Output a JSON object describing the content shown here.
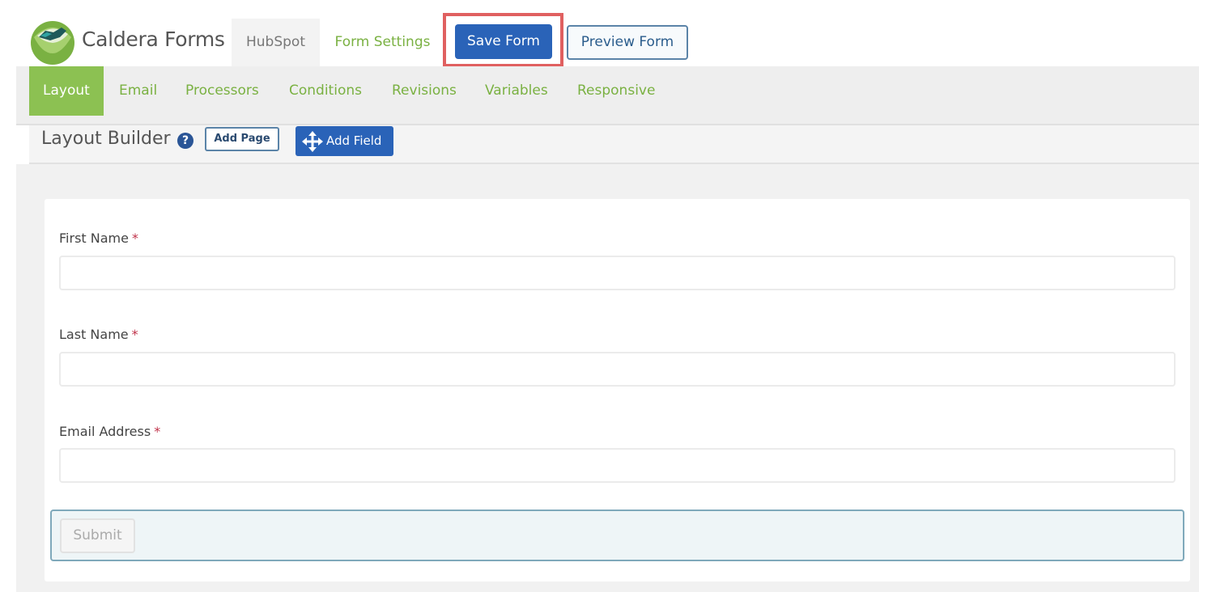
{
  "header": {
    "brand": "Caldera Forms",
    "tabs": [
      {
        "label": "HubSpot"
      },
      {
        "label": "Form Settings"
      }
    ],
    "save_label": "Save Form",
    "preview_label": "Preview Form"
  },
  "nav": {
    "items": [
      {
        "label": "Layout",
        "active": true
      },
      {
        "label": "Email"
      },
      {
        "label": "Processors"
      },
      {
        "label": "Conditions"
      },
      {
        "label": "Revisions"
      },
      {
        "label": "Variables"
      },
      {
        "label": "Responsive"
      }
    ]
  },
  "builder": {
    "title": "Layout Builder",
    "help_glyph": "?",
    "add_page_label": "Add Page",
    "add_field_label": "Add Field"
  },
  "form": {
    "fields": [
      {
        "label": "First Name",
        "required_mark": "*",
        "value": ""
      },
      {
        "label": "Last Name",
        "required_mark": "*",
        "value": ""
      },
      {
        "label": "Email Address",
        "required_mark": "*",
        "value": ""
      }
    ],
    "submit_label": "Submit"
  },
  "colors": {
    "brand_green": "#8cc152",
    "primary_blue": "#2a63b8",
    "highlight_red": "#e06060",
    "required_red": "#c0334a"
  }
}
